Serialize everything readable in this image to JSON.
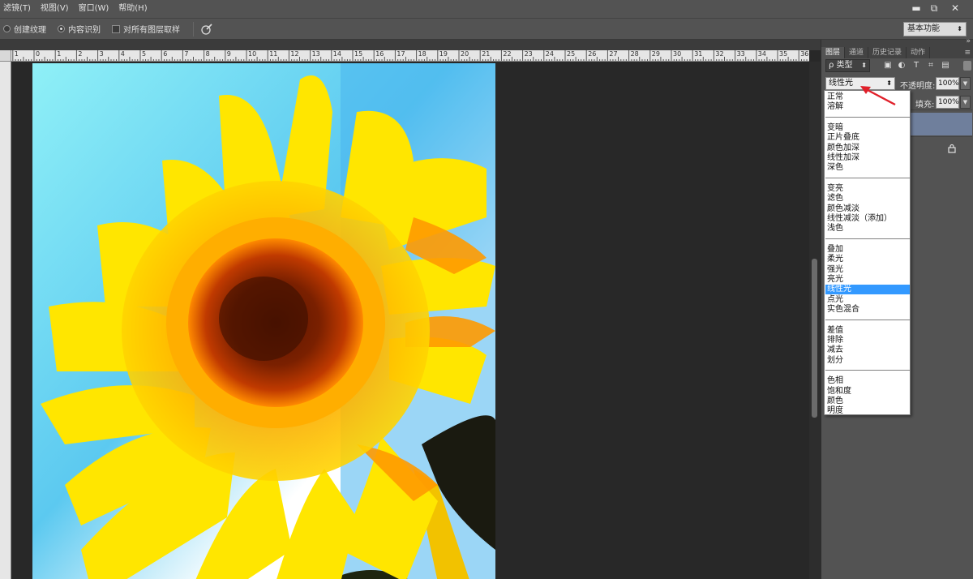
{
  "menu": {
    "items": [
      "滤镜(T)",
      "视图(V)",
      "窗口(W)",
      "帮助(H)"
    ],
    "window_controls": {
      "minimize": "▬",
      "restore": "⧉",
      "close": "✕"
    }
  },
  "options": {
    "create_texture": "创建纹理",
    "content_aware": "内容识别",
    "sample_all_layers": "对所有图层取样",
    "workspace": "基本功能"
  },
  "ruler": {
    "labels": [
      "1",
      "0",
      "1",
      "2",
      "3",
      "4",
      "5",
      "6",
      "7",
      "8",
      "9",
      "10",
      "11",
      "12",
      "13",
      "14",
      "15",
      "16",
      "17",
      "18",
      "19",
      "20",
      "21",
      "22",
      "23",
      "24",
      "25",
      "26",
      "27",
      "28",
      "29",
      "30",
      "31",
      "32",
      "33",
      "34",
      "35",
      "36"
    ]
  },
  "panel": {
    "tabs": [
      "图层",
      "通道",
      "历史记录",
      "动作"
    ],
    "kind_label": "ρ 类型",
    "blend_mode": "线性光",
    "opacity_label": "不透明度:",
    "opacity_value": "100%",
    "fill_label": "填充:",
    "fill_value": "100%"
  },
  "blend_modes": {
    "groups": [
      [
        "正常",
        "溶解"
      ],
      [
        "变暗",
        "正片叠底",
        "颜色加深",
        "线性加深",
        "深色"
      ],
      [
        "变亮",
        "滤色",
        "颜色减淡",
        "线性减淡（添加）",
        "浅色"
      ],
      [
        "叠加",
        "柔光",
        "强光",
        "亮光",
        "线性光",
        "点光",
        "实色混合"
      ],
      [
        "差值",
        "排除",
        "减去",
        "划分"
      ],
      [
        "色相",
        "饱和度",
        "颜色",
        "明度"
      ]
    ],
    "selected": "线性光"
  },
  "colors": {
    "ui_dark": "#535353",
    "canvas_bg": "#282828",
    "selection_blue": "#3399ff",
    "annotation_red": "#e0202a"
  }
}
